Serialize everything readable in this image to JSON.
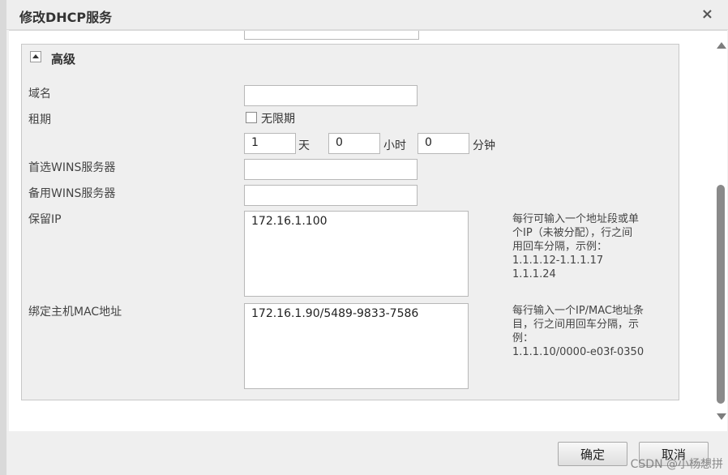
{
  "dialog": {
    "title": "修改DHCP服务",
    "close_symbol": "×"
  },
  "section": {
    "title": "高级"
  },
  "fields": {
    "domain": {
      "label": "域名",
      "value": ""
    },
    "lease": {
      "label": "租期",
      "unlimited_label": "无限期",
      "unlimited_checked": false,
      "days": "1",
      "days_unit": "天",
      "hours": "0",
      "hours_unit": "小时",
      "minutes": "0",
      "minutes_unit": "分钟"
    },
    "primary_wins": {
      "label": "首选WINS服务器",
      "value": ""
    },
    "backup_wins": {
      "label": "备用WINS服务器",
      "value": ""
    },
    "reserved_ip": {
      "label": "保留IP",
      "value": "172.16.1.100",
      "hint": [
        "每行可输入一个地址段或单",
        "个IP（未被分配），行之间",
        "用回车分隔，示例：",
        "1.1.1.12-1.1.1.17",
        "1.1.1.24"
      ]
    },
    "bind_mac": {
      "label": "绑定主机MAC地址",
      "value": "172.16.1.90/5489-9833-7586",
      "hint": [
        "每行输入一个IP/MAC地址条",
        "目，行之间用回车分隔，示",
        "例：",
        "1.1.1.10/0000-e03f-0350"
      ]
    }
  },
  "buttons": {
    "ok": "确定",
    "cancel": "取消"
  },
  "watermark": "CSDN @小杨想拼"
}
